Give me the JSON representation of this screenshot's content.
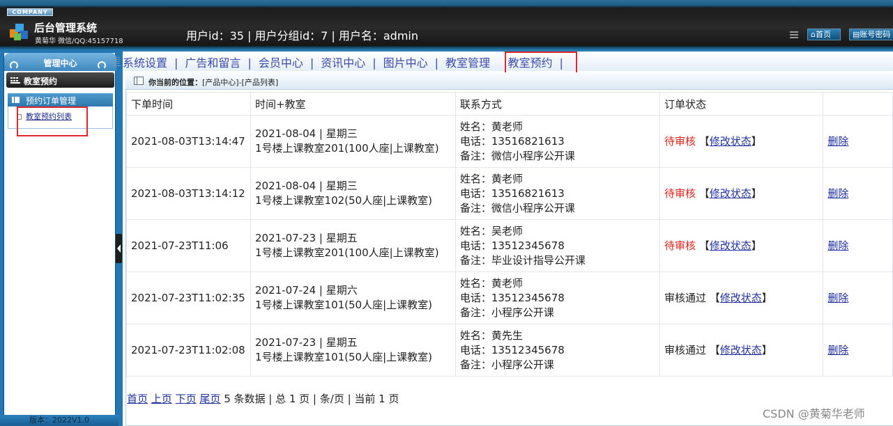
{
  "header": {
    "company_badge": "COMPANY",
    "app_title": "后台管理系统",
    "app_subtitle": "黄菊华 微信/QQ:45157718",
    "user_info": "用户id：35 | 用户分组id：7 | 用户名：admin",
    "home_button": "首页",
    "account_button": "账号密码"
  },
  "sidebar": {
    "management_label": "管理中心",
    "section_label": "教室预约",
    "group_label": "预约订单管理",
    "sub_item": "教室预约列表",
    "version": "版本：2022V1.0"
  },
  "nav": {
    "items": [
      "系统设置",
      "广告和留言",
      "会员中心",
      "资讯中心",
      "图片中心",
      "教室管理",
      "教室预约"
    ],
    "separator": "|"
  },
  "location": {
    "label": "你当前的位置：",
    "path": "[产品中心]-[产品列表]"
  },
  "table": {
    "headers": [
      "下单时间",
      "时间+教室",
      "联系方式",
      "订单状态",
      ""
    ],
    "rows": [
      {
        "order_time": "2021-08-03T13:14:47",
        "date": "2021-08-04 | 星期三",
        "room": "1号楼上课教室201(100人座|上课教室)",
        "name": "姓名：黄老师",
        "phone": "电话：13516821613",
        "note": "备注：微信小程序公开课",
        "status": "待审核",
        "modify": "修改状态",
        "delete": "删除"
      },
      {
        "order_time": "2021-08-03T13:14:12",
        "date": "2021-08-04 | 星期三",
        "room": "1号楼上课教室102(50人座|上课教室)",
        "name": "姓名：黄老师",
        "phone": "电话：13516821613",
        "note": "备注：微信小程序公开课",
        "status": "待审核",
        "modify": "修改状态",
        "delete": "删除"
      },
      {
        "order_time": "2021-07-23T11:06",
        "date": "2021-07-23 | 星期五",
        "room": "1号楼上课教室201(100人座|上课教室)",
        "name": "姓名：吴老师",
        "phone": "电话：13512345678",
        "note": "备注：毕业设计指导公开课",
        "status": "待审核",
        "modify": "修改状态",
        "delete": "删除"
      },
      {
        "order_time": "2021-07-23T11:02:35",
        "date": "2021-07-24 | 星期六",
        "room": "1号楼上课教室101(50人座|上课教室)",
        "name": "姓名：黄老师",
        "phone": "电话：13512345678",
        "note": "备注：小程序公开课",
        "status": "审核通过",
        "modify": "修改状态",
        "delete": "删除"
      },
      {
        "order_time": "2021-07-23T11:02:08",
        "date": "2021-07-23 | 星期五",
        "room": "1号楼上课教室101(50人座|上课教室)",
        "name": "姓名：黄先生",
        "phone": "电话：13512345678",
        "note": "备注：小程序公开课",
        "status": "审核通过",
        "modify": "修改状态",
        "delete": "删除"
      }
    ]
  },
  "pager": {
    "first": "首页",
    "prev": "上页",
    "next": "下页",
    "last": "尾页",
    "summary": "5 条数据 | 总 1 页 | 条/页 | 当前 1 页"
  },
  "watermark": "CSDN @黄菊华老师",
  "colors": {
    "status_pending": "#e2231a",
    "link": "#1f2f9e",
    "header_bg": "#1c1c1c",
    "frame_blue": "#2377b4",
    "highlight_box": "#e0282a"
  },
  "icons": [
    "cube-logo-icon",
    "grid-icon",
    "home-icon",
    "account-icon",
    "list-icon",
    "document-icon",
    "location-icon",
    "collapse-arrow-icon"
  ]
}
